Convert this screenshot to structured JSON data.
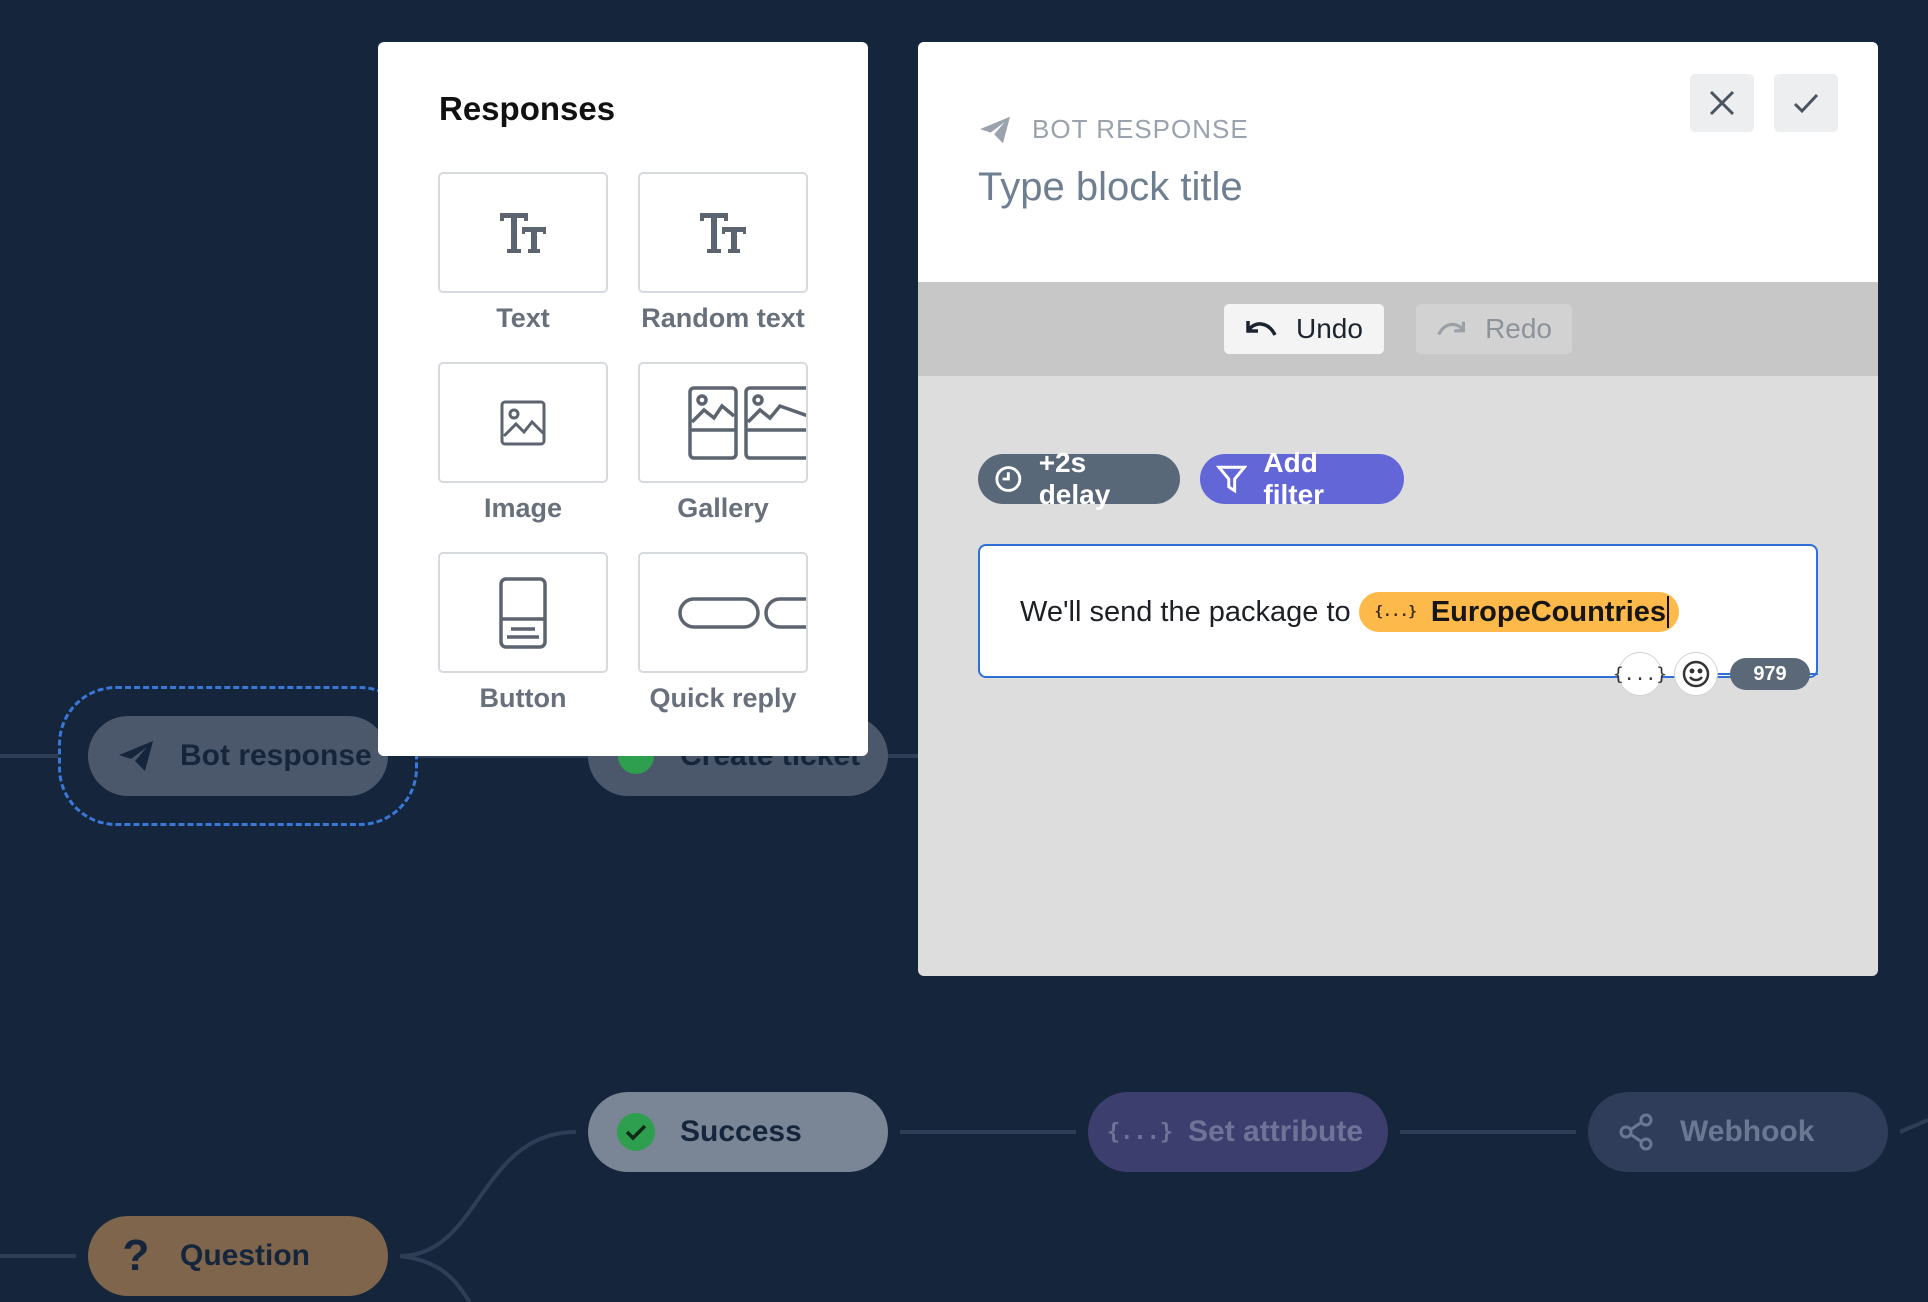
{
  "flow": {
    "nodes": {
      "bot_response": "Bot response",
      "create_ticket": "Create ticket",
      "success": "Success",
      "set_attribute": "Set attribute",
      "webhook": "Webhook",
      "question": "Question"
    },
    "icons": {
      "bot_response": "paper-plane-icon",
      "create_ticket": "ticket-icon",
      "success": "check-circle-icon",
      "set_attribute": "braces-icon",
      "webhook": "share-icon",
      "question": "question-mark-icon"
    },
    "colors": {
      "background": "#15253c",
      "selection_outline": "#3a78d8",
      "success_check": "#2e9e4f"
    }
  },
  "responses_panel": {
    "title": "Responses",
    "items": [
      {
        "label": "Text",
        "icon": "text-format-icon"
      },
      {
        "label": "Random text",
        "icon": "random-text-icon"
      },
      {
        "label": "Image",
        "icon": "image-icon"
      },
      {
        "label": "Gallery",
        "icon": "gallery-icon"
      },
      {
        "label": "Button",
        "icon": "button-icon"
      },
      {
        "label": "Quick reply",
        "icon": "quick-reply-icon"
      }
    ]
  },
  "editor": {
    "kind_label": "BOT RESPONSE",
    "title_placeholder": "Type block title",
    "toolbar": {
      "undo": "Undo",
      "redo": "Redo"
    },
    "delay_chip": "+2s delay",
    "filter_chip": "Add filter",
    "message": {
      "text": "We'll send the package to",
      "attribute": "EuropeCountries",
      "attribute_icon_text": "{...}",
      "char_count": "979"
    },
    "colors": {
      "filter_chip": "#6266d6",
      "attribute_pill": "#fdb94a",
      "focus_border": "#2f6fd6"
    }
  }
}
